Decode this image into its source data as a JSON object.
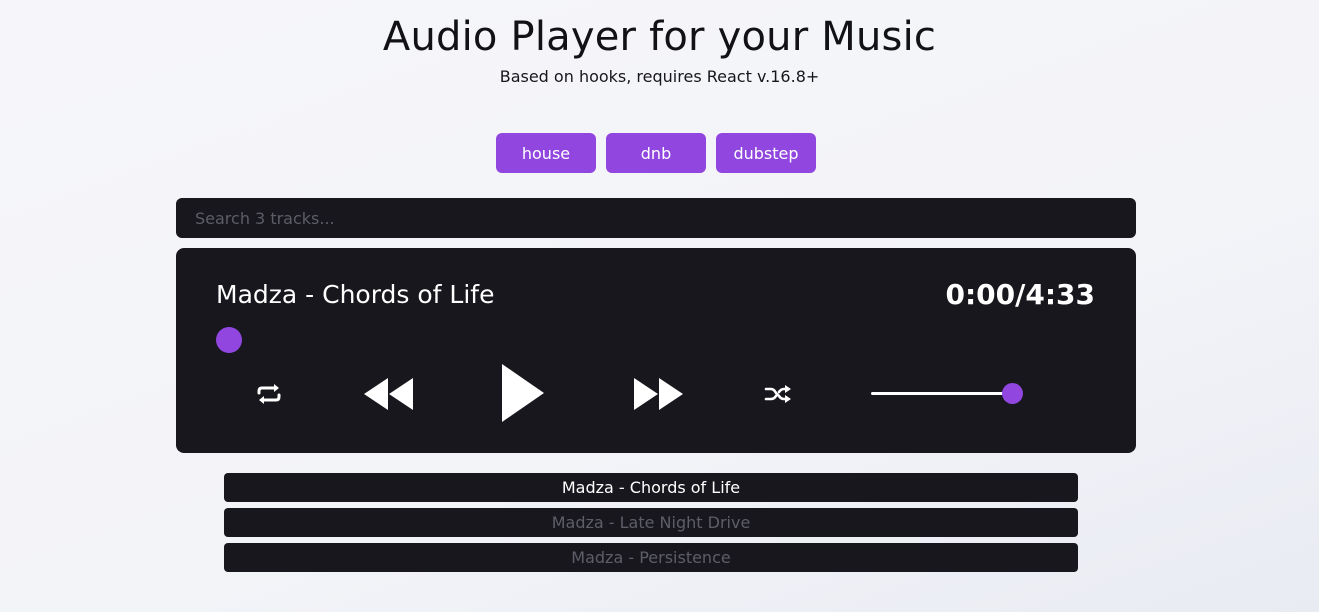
{
  "header": {
    "title": "Audio Player for your Music",
    "subtitle": "Based on hooks, requires React v.16.8+"
  },
  "tags": [
    {
      "label": "house"
    },
    {
      "label": "dnb"
    },
    {
      "label": "dubstep"
    }
  ],
  "search": {
    "placeholder": "Search 3 tracks...",
    "value": ""
  },
  "player": {
    "track_title": "Madza - Chords of Life",
    "time": "0:00/4:33",
    "progress_fraction": 0,
    "volume_fraction": 1,
    "icons": {
      "repeat": "repeat-icon",
      "previous": "rewind-icon",
      "play": "play-icon",
      "next": "fast-forward-icon",
      "shuffle": "shuffle-icon"
    }
  },
  "playlist": {
    "items": [
      {
        "label": "Madza - Chords of Life",
        "active": true
      },
      {
        "label": "Madza - Late Night Drive",
        "active": false
      },
      {
        "label": "Madza - Persistence",
        "active": false
      }
    ]
  },
  "colors": {
    "accent": "#9146e0",
    "panel": "#17171d",
    "inactive_text": "#5e5e68",
    "background": "#f4f5f9"
  }
}
